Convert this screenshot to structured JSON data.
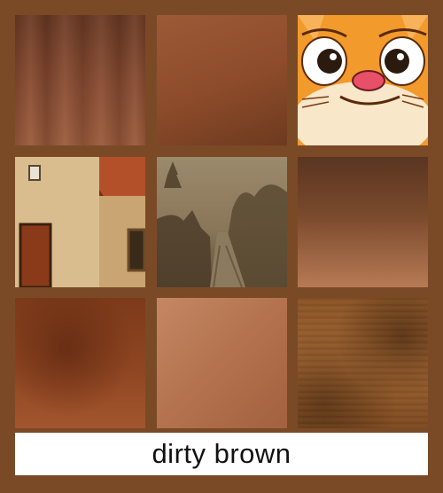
{
  "caption": "dirty brown",
  "tiles": [
    {
      "subject": "draped-fabric"
    },
    {
      "subject": "smooth-gradient"
    },
    {
      "subject": "cartoon-cat-face"
    },
    {
      "subject": "old-house"
    },
    {
      "subject": "foggy-forest-road"
    },
    {
      "subject": "smooth-gradient"
    },
    {
      "subject": "smooth-gradient"
    },
    {
      "subject": "smooth-gradient"
    },
    {
      "subject": "wood-grain"
    }
  ],
  "colors": {
    "background": "#7a4a27",
    "caption_bar": "#ffffff",
    "caption_text": "#111111"
  }
}
